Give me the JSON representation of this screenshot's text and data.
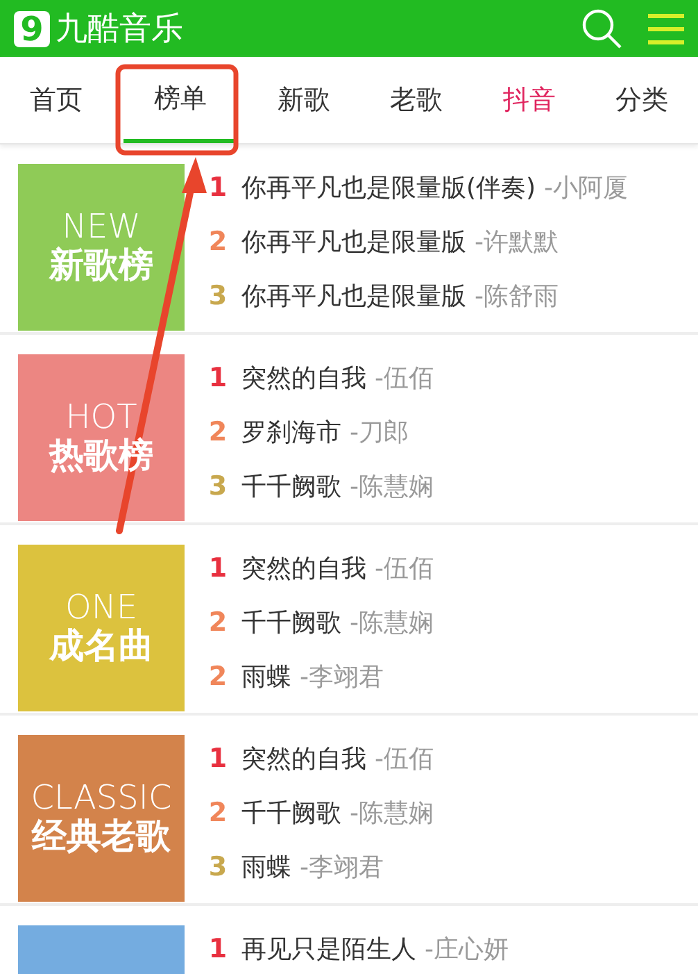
{
  "header": {
    "logo_mark": "9",
    "title": "九酷音乐"
  },
  "tabs": [
    {
      "label": "首页",
      "selected": false,
      "hot": false
    },
    {
      "label": "榜单",
      "selected": true,
      "hot": false
    },
    {
      "label": "新歌",
      "selected": false,
      "hot": false
    },
    {
      "label": "老歌",
      "selected": false,
      "hot": false
    },
    {
      "label": "抖音",
      "selected": false,
      "hot": true
    },
    {
      "label": "分类",
      "selected": false,
      "hot": false
    }
  ],
  "charts": [
    {
      "en": "NEW",
      "zh": "新歌榜",
      "color": "#8fcb57",
      "songs": [
        {
          "rank": "1",
          "color": "#e8303f",
          "title": "你再平凡也是限量版(伴奏)",
          "artist": "-小阿厦"
        },
        {
          "rank": "2",
          "color": "#f0865a",
          "title": "你再平凡也是限量版",
          "artist": "-许默默"
        },
        {
          "rank": "3",
          "color": "#c8a84e",
          "title": "你再平凡也是限量版",
          "artist": "-陈舒雨"
        }
      ]
    },
    {
      "en": "HOT",
      "zh": "热歌榜",
      "color": "#ec8682",
      "songs": [
        {
          "rank": "1",
          "color": "#e8303f",
          "title": "突然的自我",
          "artist": "-伍佰"
        },
        {
          "rank": "2",
          "color": "#f0865a",
          "title": "罗刹海市",
          "artist": "-刀郎"
        },
        {
          "rank": "3",
          "color": "#c8a84e",
          "title": "千千阙歌",
          "artist": "-陈慧娴"
        }
      ]
    },
    {
      "en": "ONE",
      "zh": "成名曲",
      "color": "#dcc23e",
      "songs": [
        {
          "rank": "1",
          "color": "#e8303f",
          "title": "突然的自我",
          "artist": "-伍佰"
        },
        {
          "rank": "2",
          "color": "#f0865a",
          "title": "千千阙歌",
          "artist": "-陈慧娴"
        },
        {
          "rank": "2",
          "color": "#f0865a",
          "title": "雨蝶",
          "artist": "-李翊君"
        }
      ]
    },
    {
      "en": "CLASSIC",
      "zh": "经典老歌",
      "color": "#d3834b",
      "songs": [
        {
          "rank": "1",
          "color": "#e8303f",
          "title": "突然的自我",
          "artist": "-伍佰"
        },
        {
          "rank": "2",
          "color": "#f0865a",
          "title": "千千阙歌",
          "artist": "-陈慧娴"
        },
        {
          "rank": "3",
          "color": "#c8a84e",
          "title": "雨蝶",
          "artist": "-李翊君"
        }
      ]
    },
    {
      "color": "#74ace0",
      "songs": [
        {
          "rank": "1",
          "color": "#e8303f",
          "title": "再见只是陌生人",
          "artist": "-庄心妍"
        }
      ]
    }
  ]
}
